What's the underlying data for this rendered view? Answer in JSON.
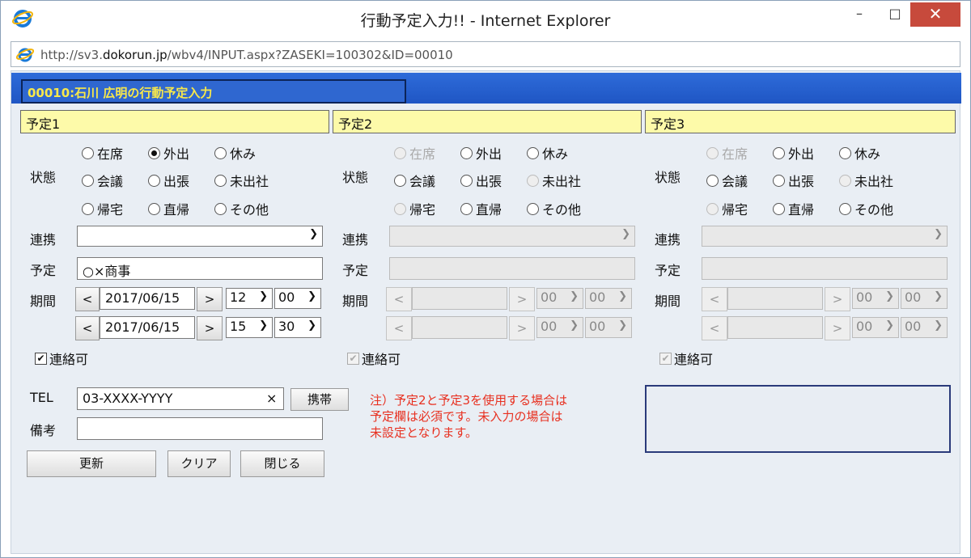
{
  "window": {
    "title": "行動予定入力!! - Internet Explorer",
    "address_prefix": "http://sv3.",
    "address_domain": "dokorun.jp",
    "address_suffix": "/wbv4/INPUT.aspx?ZASEKI=100302&ID=00010"
  },
  "header": {
    "banner": "00010:石川 広明の行動予定入力"
  },
  "labels": {
    "status": "状態",
    "link": "連携",
    "plan": "予定",
    "period": "期間",
    "contact": "連絡可",
    "tel": "TEL",
    "remarks": "備考"
  },
  "status_options": [
    "在席",
    "外出",
    "休み",
    "会議",
    "出張",
    "未出社",
    "帰宅",
    "直帰",
    "その他"
  ],
  "plans": [
    {
      "heading": "予定1",
      "selected_status": "外出",
      "link_value": "",
      "plan_value": "○×商事",
      "start_date": "2017/06/15",
      "start_hour": "12",
      "start_min": "00",
      "end_date": "2017/06/15",
      "end_hour": "15",
      "end_min": "30",
      "contact_checked": true
    },
    {
      "heading": "予定2",
      "selected_status": "",
      "link_value": "",
      "plan_value": "",
      "start_date": "",
      "start_hour": "00",
      "start_min": "00",
      "end_date": "",
      "end_hour": "00",
      "end_min": "00",
      "contact_checked": true
    },
    {
      "heading": "予定3",
      "selected_status": "",
      "link_value": "",
      "plan_value": "",
      "start_date": "",
      "start_hour": "00",
      "start_min": "00",
      "end_date": "",
      "end_hour": "00",
      "end_min": "00",
      "contact_checked": true
    }
  ],
  "nav": {
    "prev": "<",
    "next": ">"
  },
  "tel": {
    "value": "03-XXXX-YYYY",
    "clear": "×",
    "mobile_button": "携帯"
  },
  "remarks_value": "",
  "buttons": {
    "update": "更新",
    "clear": "クリア",
    "close": "閉じる"
  },
  "note": {
    "line1": "注）予定2と予定3を使用する場合は",
    "line2": "予定欄は必須です。未入力の場合は",
    "line3": "未設定となります。"
  }
}
